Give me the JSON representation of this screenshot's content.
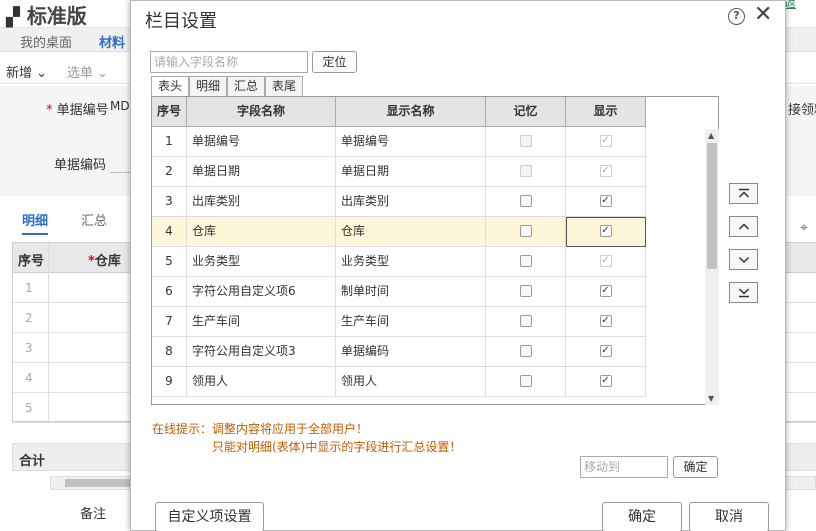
{
  "app": {
    "title": "标准版",
    "corner_link": "返"
  },
  "nav": {
    "tabs": [
      "我的桌面",
      "材料"
    ]
  },
  "toolbar": {
    "new_label": "新增",
    "select_label": "选单"
  },
  "form": {
    "doc_no_label": "单据编号",
    "doc_no_value": "MD-",
    "doc_code_label": "单据编码",
    "right_label": "接领料"
  },
  "subtabs": [
    "明细",
    "汇总"
  ],
  "bg_grid": {
    "headers": [
      "序号",
      "仓库"
    ],
    "rows": [
      "1",
      "2",
      "3",
      "4",
      "5"
    ]
  },
  "bg_footer": {
    "total_label": "合计",
    "remark_label": "备注"
  },
  "modal": {
    "title": "栏目设置",
    "search_placeholder": "请输入字段名称",
    "locate_label": "定位",
    "tabs": [
      "表头",
      "明细",
      "汇总",
      "表尾"
    ],
    "active_tab": "表头",
    "columns": [
      "序号",
      "字段名称",
      "显示名称",
      "记忆",
      "显示"
    ],
    "rows": [
      {
        "no": "1",
        "field": "单据编号",
        "display": "单据编号",
        "memory": "disabled-off",
        "show": "disabled-on"
      },
      {
        "no": "2",
        "field": "单据日期",
        "display": "单据日期",
        "memory": "disabled-off",
        "show": "disabled-on"
      },
      {
        "no": "3",
        "field": "出库类别",
        "display": "出库类别",
        "memory": "off",
        "show": "on"
      },
      {
        "no": "4",
        "field": "仓库",
        "display": "仓库",
        "memory": "off",
        "show": "on"
      },
      {
        "no": "5",
        "field": "业务类型",
        "display": "业务类型",
        "memory": "off",
        "show": "disabled-on"
      },
      {
        "no": "6",
        "field": "字符公用自定义项6",
        "display": "制单时间",
        "memory": "off",
        "show": "on"
      },
      {
        "no": "7",
        "field": "生产车间",
        "display": "生产车间",
        "memory": "off",
        "show": "on"
      },
      {
        "no": "8",
        "field": "字符公用自定义项3",
        "display": "单据编码",
        "memory": "off",
        "show": "on"
      },
      {
        "no": "9",
        "field": "领用人",
        "display": "领用人",
        "memory": "off",
        "show": "on"
      }
    ],
    "selected_row": "4",
    "hint_line1": "在线提示：调整内容将应用于全部用户！",
    "hint_line2": "只能对明细(表体)中显示的字段进行汇总设置！",
    "move_to_placeholder": "移动到",
    "move_ok_label": "确定",
    "custom_btn_label": "自定义项设置",
    "ok_label": "确定",
    "cancel_label": "取消",
    "move_buttons": [
      "move-top-icon",
      "move-up-icon",
      "move-down-icon",
      "move-bottom-icon"
    ]
  }
}
